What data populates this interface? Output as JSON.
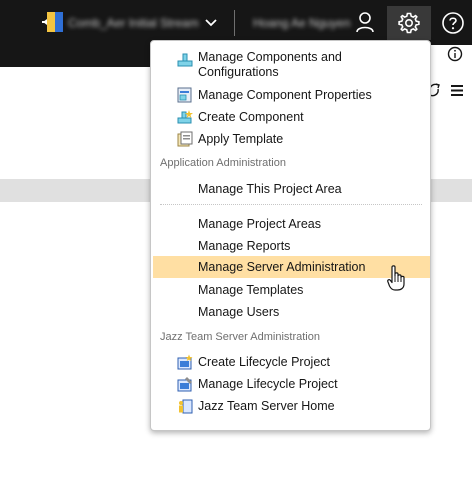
{
  "topbar": {
    "project_name": "Comb_Aer Initial Stream",
    "user_name": "Hoang Ae Nguyen",
    "icons": [
      "project-icon",
      "chevron-down-icon",
      "user-icon",
      "gear-icon",
      "help-icon"
    ]
  },
  "toolbar": {
    "icons": [
      "info-icon",
      "sync-icon",
      "hamburger-menu-icon"
    ]
  },
  "menu": {
    "group1": [
      {
        "label": "Manage Components and Configurations",
        "icon": "components-icon"
      },
      {
        "label": "Manage Component Properties",
        "icon": "component-properties-icon"
      },
      {
        "label": "Create Component",
        "icon": "create-component-icon"
      },
      {
        "label": "Apply Template",
        "icon": "template-icon"
      }
    ],
    "section_app_admin": "Application Administration",
    "group2": [
      {
        "label": "Manage This Project Area"
      }
    ],
    "group3": [
      {
        "label": "Manage Project Areas"
      },
      {
        "label": "Manage Reports"
      },
      {
        "label": "Manage Server Administration",
        "highlighted": true
      },
      {
        "label": "Manage Templates"
      },
      {
        "label": "Manage Users"
      }
    ],
    "section_jts_admin": "Jazz Team Server Administration",
    "group4": [
      {
        "label": "Create Lifecycle Project",
        "icon": "create-lifecycle-icon"
      },
      {
        "label": "Manage Lifecycle Project",
        "icon": "manage-lifecycle-icon"
      },
      {
        "label": "Jazz Team Server Home",
        "icon": "jts-home-icon"
      }
    ],
    "highlight_color": "#ffdfa3"
  }
}
